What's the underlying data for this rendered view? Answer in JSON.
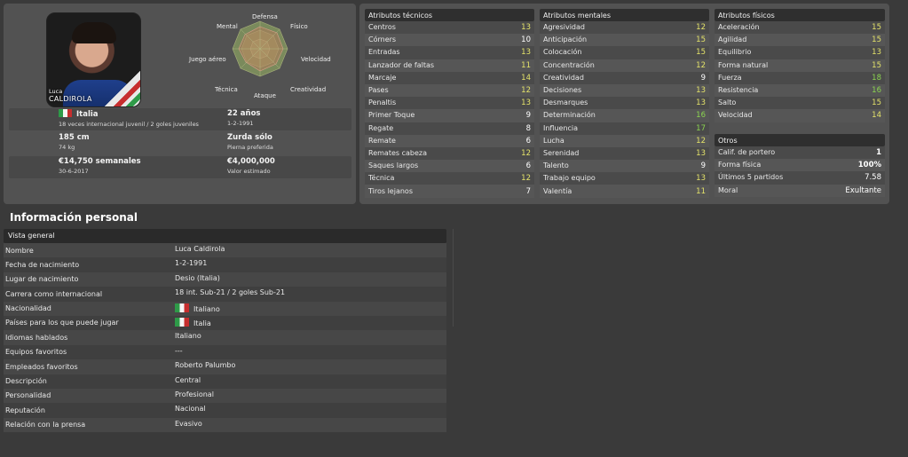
{
  "player": {
    "first_name": "Luca",
    "last_name": "CALDIROLA",
    "nationality": "Italia",
    "caps": "18 veces internacional juvenil / 2 goles juveniles",
    "age": "22 años",
    "birth": "1-2-1991",
    "height": "185 cm",
    "weight": "74 kg",
    "foot": "Zurda sólo",
    "foot_sub": "Pierna preferida",
    "wage": "€14,750 semanales",
    "contract": "30-6-2017",
    "value": "€4,000,000",
    "value_sub": "Valor estimado"
  },
  "radar": {
    "labels": {
      "defensa": "Defensa",
      "fisico": "Físico",
      "velocidad": "Velocidad",
      "creatividad": "Creatividad",
      "ataque": "Ataque",
      "tecnica": "Técnica",
      "juego_aereo": "Juego aéreo",
      "mental": "Mental"
    }
  },
  "technical": {
    "title": "Atributos técnicos",
    "items": [
      {
        "label": "Centros",
        "value": "13",
        "tone": "yellow"
      },
      {
        "label": "Córners",
        "value": "10",
        "tone": "white"
      },
      {
        "label": "Entradas",
        "value": "13",
        "tone": "yellow"
      },
      {
        "label": "Lanzador de faltas",
        "value": "11",
        "tone": "yellow"
      },
      {
        "label": "Marcaje",
        "value": "14",
        "tone": "yellow"
      },
      {
        "label": "Pases",
        "value": "12",
        "tone": "yellow"
      },
      {
        "label": "Penaltis",
        "value": "13",
        "tone": "yellow"
      },
      {
        "label": "Primer Toque",
        "value": "9",
        "tone": "white"
      },
      {
        "label": "Regate",
        "value": "8",
        "tone": "white"
      },
      {
        "label": "Remate",
        "value": "6",
        "tone": "white"
      },
      {
        "label": "Remates cabeza",
        "value": "12",
        "tone": "yellow"
      },
      {
        "label": "Saques largos",
        "value": "6",
        "tone": "white"
      },
      {
        "label": "Técnica",
        "value": "12",
        "tone": "yellow"
      },
      {
        "label": "Tiros lejanos",
        "value": "7",
        "tone": "white"
      }
    ]
  },
  "mental": {
    "title": "Atributos mentales",
    "items": [
      {
        "label": "Agresividad",
        "value": "12",
        "tone": "yellow"
      },
      {
        "label": "Anticipación",
        "value": "15",
        "tone": "yellow"
      },
      {
        "label": "Colocación",
        "value": "15",
        "tone": "yellow"
      },
      {
        "label": "Concentración",
        "value": "12",
        "tone": "yellow"
      },
      {
        "label": "Creatividad",
        "value": "9",
        "tone": "white"
      },
      {
        "label": "Decisiones",
        "value": "13",
        "tone": "yellow"
      },
      {
        "label": "Desmarques",
        "value": "13",
        "tone": "yellow"
      },
      {
        "label": "Determinación",
        "value": "16",
        "tone": "green"
      },
      {
        "label": "Influencia",
        "value": "17",
        "tone": "green"
      },
      {
        "label": "Lucha",
        "value": "12",
        "tone": "yellow"
      },
      {
        "label": "Serenidad",
        "value": "13",
        "tone": "yellow"
      },
      {
        "label": "Talento",
        "value": "9",
        "tone": "white"
      },
      {
        "label": "Trabajo equipo",
        "value": "13",
        "tone": "yellow"
      },
      {
        "label": "Valentía",
        "value": "11",
        "tone": "yellow"
      }
    ]
  },
  "physical": {
    "title": "Atributos físicos",
    "items": [
      {
        "label": "Aceleración",
        "value": "15",
        "tone": "yellow"
      },
      {
        "label": "Agilidad",
        "value": "15",
        "tone": "yellow"
      },
      {
        "label": "Equilibrio",
        "value": "13",
        "tone": "yellow"
      },
      {
        "label": "Forma natural",
        "value": "15",
        "tone": "yellow"
      },
      {
        "label": "Fuerza",
        "value": "18",
        "tone": "green"
      },
      {
        "label": "Resistencia",
        "value": "16",
        "tone": "green"
      },
      {
        "label": "Salto",
        "value": "15",
        "tone": "yellow"
      },
      {
        "label": "Velocidad",
        "value": "14",
        "tone": "yellow"
      }
    ]
  },
  "others": {
    "title": "Otros",
    "items": [
      {
        "label": "Calif. de portero",
        "value": "1",
        "tone": "bold"
      },
      {
        "label": "Forma física",
        "value": "100%",
        "tone": "bold"
      },
      {
        "label": "Últimos 5 partidos",
        "value": "7.58",
        "tone": "white"
      },
      {
        "label": "Moral",
        "value": "Exultante",
        "tone": "white"
      }
    ]
  },
  "personal": {
    "title": "Información personal",
    "header": "Vista general",
    "rows": [
      {
        "label": "Nombre",
        "value": "Luca Caldirola",
        "flag": false
      },
      {
        "label": "Fecha de nacimiento",
        "value": "1-2-1991",
        "flag": false
      },
      {
        "label": "Lugar de nacimiento",
        "value": "Desio (Italia)",
        "flag": false
      },
      {
        "label": "Carrera como internacional",
        "value": "18 int. Sub-21 / 2 goles Sub-21",
        "flag": false
      },
      {
        "label": "Nacionalidad",
        "value": "Italiano",
        "flag": true
      },
      {
        "label": "Países para los que puede jugar",
        "value": "Italia",
        "flag": true
      },
      {
        "label": "Idiomas hablados",
        "value": "Italiano",
        "flag": false
      },
      {
        "label": "Equipos favoritos",
        "value": "---",
        "flag": false
      },
      {
        "label": "Empleados favoritos",
        "value": "Roberto Palumbo",
        "flag": false
      },
      {
        "label": "Descripción",
        "value": "Central",
        "flag": false
      },
      {
        "label": "Personalidad",
        "value": "Profesional",
        "flag": false
      },
      {
        "label": "Reputación",
        "value": "Nacional",
        "flag": false
      },
      {
        "label": "Relación con la prensa",
        "value": "Evasivo",
        "flag": false
      }
    ]
  }
}
